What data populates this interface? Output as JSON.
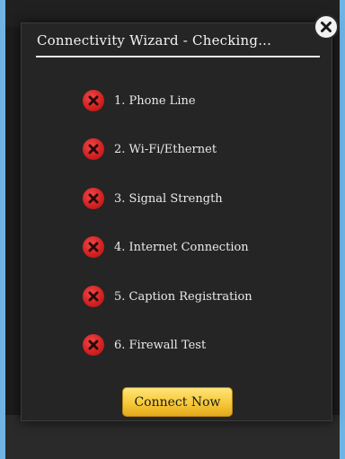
{
  "dialog": {
    "title": "Connectivity Wizard - Checking...",
    "close_icon": "close-icon",
    "items": [
      {
        "label": "1. Phone Line",
        "status": "failed",
        "icon": "x-circle-icon"
      },
      {
        "label": "2. Wi-Fi/Ethernet",
        "status": "failed",
        "icon": "x-circle-icon"
      },
      {
        "label": "3. Signal Strength",
        "status": "failed",
        "icon": "x-circle-icon"
      },
      {
        "label": "4. Internet Connection",
        "status": "failed",
        "icon": "x-circle-icon"
      },
      {
        "label": "5. Caption Registration",
        "status": "failed",
        "icon": "x-circle-icon"
      },
      {
        "label": "6. Firewall Test",
        "status": "failed",
        "icon": "x-circle-icon"
      }
    ],
    "connect_button_label": "Connect Now"
  },
  "colors": {
    "backdrop": "#6fb4e4",
    "dialog_bg": "#252525",
    "fail_red": "#d42222",
    "button_gold": "#f6c938"
  }
}
